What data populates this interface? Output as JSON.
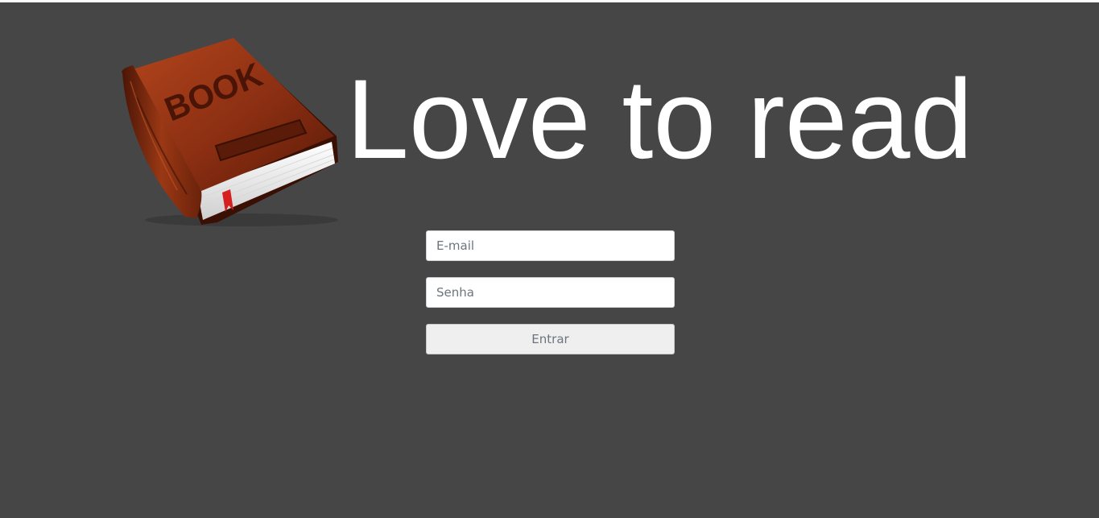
{
  "logo": {
    "name": "book-icon",
    "cover_text": "BOOK",
    "colors": {
      "cover": "#8a2e12",
      "cover_dark": "#4a1506",
      "cover_light": "#b2451c",
      "pages": "#f2f2f2",
      "bookmark": "#d61f1f"
    }
  },
  "header": {
    "title": "Love to read"
  },
  "login_form": {
    "email_placeholder": "E-mail",
    "password_placeholder": "Senha",
    "submit_label": "Entrar"
  },
  "colors": {
    "background": "#464646",
    "title": "#ffffff",
    "input_background": "#ffffff",
    "button_background": "#efefef"
  }
}
